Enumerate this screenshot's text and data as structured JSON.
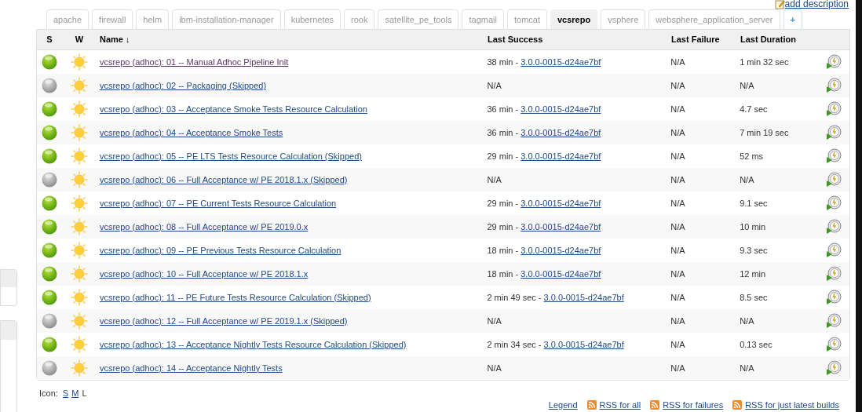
{
  "add_description": "add description",
  "tabs": [
    {
      "label": "apache",
      "selected": false
    },
    {
      "label": "firewall",
      "selected": false
    },
    {
      "label": "helm",
      "selected": false
    },
    {
      "label": "ibm-installation-manager",
      "selected": false
    },
    {
      "label": "kubernetes",
      "selected": false
    },
    {
      "label": "rook",
      "selected": false
    },
    {
      "label": "satellite_pe_tools",
      "selected": false
    },
    {
      "label": "tagmail",
      "selected": false
    },
    {
      "label": "tomcat",
      "selected": false
    },
    {
      "label": "vcsrepo",
      "selected": true
    },
    {
      "label": "vsphere",
      "selected": false
    },
    {
      "label": "websphere_application_server",
      "selected": false
    },
    {
      "label": "+",
      "selected": false
    }
  ],
  "columns": [
    "S",
    "W",
    "Name ↓",
    "Last Success",
    "Last Failure",
    "Last Duration"
  ],
  "rows": [
    {
      "kind": "success",
      "name": "vcsrepo (adhoc): 01 -- Manual Adhoc Pipeline Init",
      "visited": true,
      "success_time": "38 min - ",
      "success_build": "3.0.0-0015-d24ae7bf",
      "last_failure": "N/A",
      "duration": "1 min 32 sec"
    },
    {
      "kind": "notbuilt",
      "name": "vcsrepo (adhoc): 02 -- Packaging (Skipped)",
      "visited": false,
      "success_time": "N/A",
      "last_failure": "N/A",
      "duration": "N/A"
    },
    {
      "kind": "success",
      "name": "vcsrepo (adhoc): 03 -- Acceptance Smoke Tests Resource Calculation",
      "visited": false,
      "success_time": "36 min - ",
      "success_build": "3.0.0-0015-d24ae7bf",
      "last_failure": "N/A",
      "duration": "4.7 sec"
    },
    {
      "kind": "success",
      "name": "vcsrepo (adhoc): 04 -- Acceptance Smoke Tests",
      "visited": false,
      "success_time": "36 min - ",
      "success_build": "3.0.0-0015-d24ae7bf",
      "last_failure": "N/A",
      "duration": "7 min 19 sec"
    },
    {
      "kind": "success",
      "name": "vcsrepo (adhoc): 05 -- PE LTS Tests Resource Calculation (Skipped)",
      "visited": false,
      "success_time": "29 min - ",
      "success_build": "3.0.0-0015-d24ae7bf",
      "last_failure": "N/A",
      "duration": "52 ms"
    },
    {
      "kind": "notbuilt",
      "name": "vcsrepo (adhoc): 06 -- Full Acceptance w/ PE 2018.1.x (Skipped)",
      "visited": false,
      "success_time": "N/A",
      "last_failure": "N/A",
      "duration": "N/A"
    },
    {
      "kind": "success",
      "name": "vcsrepo (adhoc): 07 -- PE Current Tests Resource Calculation",
      "visited": false,
      "success_time": "29 min - ",
      "success_build": "3.0.0-0015-d24ae7bf",
      "last_failure": "N/A",
      "duration": "9.1 sec"
    },
    {
      "kind": "success",
      "name": "vcsrepo (adhoc): 08 -- Full Acceptance w/ PE 2019.0.x",
      "visited": false,
      "success_time": "29 min - ",
      "success_build": "3.0.0-0015-d24ae7bf",
      "last_failure": "N/A",
      "duration": "10 min"
    },
    {
      "kind": "success",
      "name": "vcsrepo (adhoc): 09 -- PE Previous Tests Resource Calculation",
      "visited": false,
      "success_time": "18 min - ",
      "success_build": "3.0.0-0015-d24ae7bf",
      "last_failure": "N/A",
      "duration": "9.3 sec"
    },
    {
      "kind": "success",
      "name": "vcsrepo (adhoc): 10 -- Full Acceptance w/ PE 2018.1.x",
      "visited": false,
      "success_time": "18 min - ",
      "success_build": "3.0.0-0015-d24ae7bf",
      "last_failure": "N/A",
      "duration": "12 min"
    },
    {
      "kind": "success",
      "name": "vcsrepo (adhoc): 11 -- PE Future Tests Resource Calculation (Skipped)",
      "visited": false,
      "success_time": "2 min 49 sec - ",
      "success_build": "3.0.0-0015-d24ae7bf",
      "last_failure": "N/A",
      "duration": "8.5 sec"
    },
    {
      "kind": "notbuilt",
      "name": "vcsrepo (adhoc): 12 -- Full Acceptance w/ PE 2019.1.x (Skipped)",
      "visited": false,
      "success_time": "N/A",
      "last_failure": "N/A",
      "duration": "N/A"
    },
    {
      "kind": "success",
      "name": "vcsrepo (adhoc): 13 -- Acceptance Nightly Tests Resource Calculation (Skipped)",
      "visited": false,
      "success_time": "2 min 34 sec - ",
      "success_build": "3.0.0-0015-d24ae7bf",
      "last_failure": "N/A",
      "duration": "0.13 sec"
    },
    {
      "kind": "notbuilt",
      "name": "vcsrepo (adhoc): 14 -- Acceptance Nightly Tests",
      "visited": false,
      "success_time": "N/A",
      "last_failure": "N/A",
      "duration": "N/A"
    }
  ],
  "icon_size": {
    "label": "Icon:",
    "options": [
      {
        "label": "S",
        "selected": false
      },
      {
        "label": "M",
        "selected": false
      },
      {
        "label": "L",
        "selected": true
      }
    ]
  },
  "footer_links": [
    "Legend",
    "RSS for all",
    "RSS for failures",
    "RSS for just latest builds"
  ]
}
